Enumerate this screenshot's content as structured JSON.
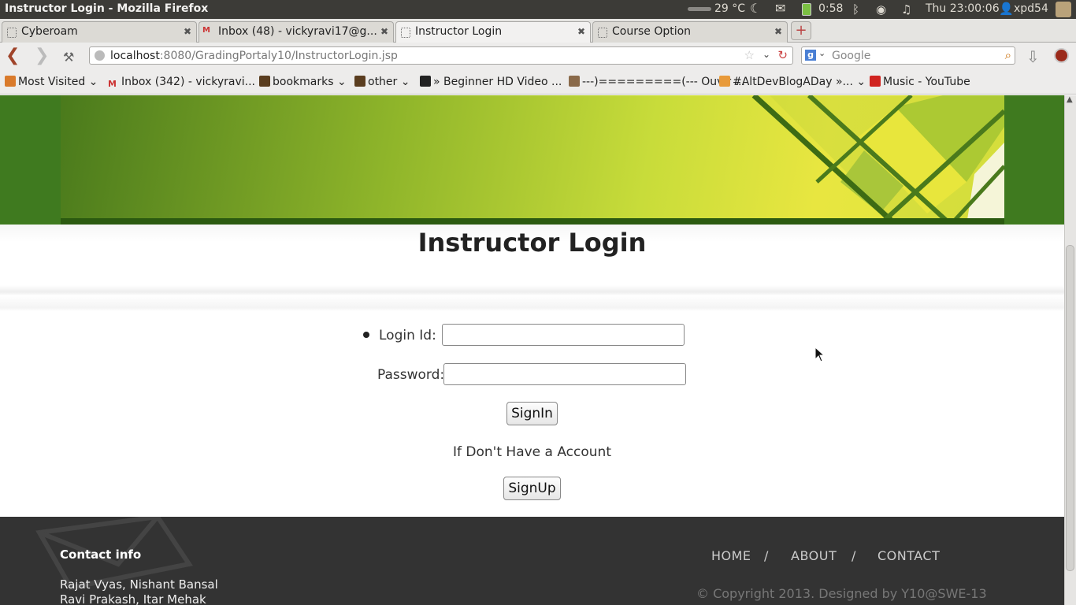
{
  "system": {
    "window_title": "Instructor Login - Mozilla Firefox",
    "temperature": "29 °C",
    "battery_time": "0:58",
    "clock": "Thu 23:00:06",
    "user": "xpd54"
  },
  "tabs": [
    {
      "label": "Cyberoam"
    },
    {
      "label": "Inbox (48) - vickyravi17@g..."
    },
    {
      "label": "Instructor Login"
    },
    {
      "label": "Course Option"
    }
  ],
  "new_tab_symbol": "+",
  "navigation": {
    "url_host": "localhost",
    "url_rest": ":8080/GradingPortaly10/InstructorLogin.jsp",
    "search_placeholder": "Google"
  },
  "bookmarks": [
    {
      "label": "Most Visited",
      "has_menu": true
    },
    {
      "label": "Inbox (342) - vickyravi...",
      "has_menu": false
    },
    {
      "label": "bookmarks",
      "has_menu": true
    },
    {
      "label": "other",
      "has_menu": true
    },
    {
      "label": "» Beginner HD Video ...",
      "has_menu": false
    },
    {
      "label": "---)=========(--- Ouvir ...",
      "has_menu": false
    },
    {
      "label": "#AltDevBlogADay »...",
      "has_menu": true
    },
    {
      "label": "Music - YouTube",
      "has_menu": false
    }
  ],
  "page": {
    "title": "Instructor Login",
    "login_label": "Login Id:",
    "login_value": "",
    "password_label": "Password:",
    "password_value": "",
    "signin_label": "SignIn",
    "no_account_text": "If Don't Have a Account",
    "signup_label": "SignUp"
  },
  "footer": {
    "contact_heading": "Contact info",
    "names_line1": "Rajat Vyas, Nishant Bansal",
    "names_line2": "Ravi Prakash, Itar Mehak",
    "nav": [
      "HOME",
      "ABOUT",
      "CONTACT"
    ],
    "separator": "/",
    "copyright": "© Copyright 2013. Designed by Y10@SWE-13"
  },
  "colors": {
    "banner_green": "#3f7a1f",
    "footer_bg": "#333333",
    "system_bar": "#3c3b37"
  }
}
